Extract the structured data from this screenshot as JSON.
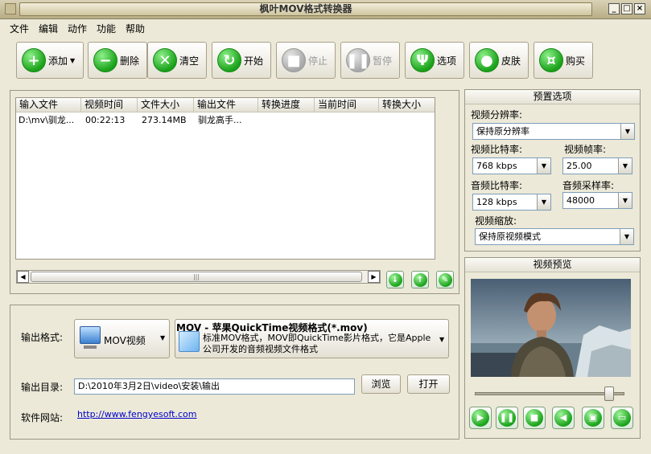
{
  "window": {
    "title": "枫叶MOV格式转换器",
    "min": "_",
    "max": "□",
    "close": "×"
  },
  "menu": [
    "文件",
    "编辑",
    "动作",
    "功能",
    "帮助"
  ],
  "toolbar": {
    "add": "添加",
    "delete": "删除",
    "clear": "清空",
    "start": "开始",
    "stop": "停止",
    "pause": "暂停",
    "options": "选项",
    "skin": "皮肤",
    "buy": "购买"
  },
  "table": {
    "headers": [
      "输入文件",
      "视频时间",
      "文件大小",
      "输出文件",
      "转换进度",
      "当前时间",
      "转换大小"
    ],
    "rows": [
      [
        "D:\\mv\\驯龙...",
        "00:22:13",
        "273.14MB",
        "驯龙高手...",
        "",
        "",
        ""
      ]
    ]
  },
  "output": {
    "format_label": "输出格式:",
    "format_button": "MOV视频",
    "format_title": "MOV - 苹果QuickTime视频格式(*.mov)",
    "format_desc": "标准MOV格式，MOV即QuickTime影片格式，它是Apple公司开发的音频视频文件格式",
    "dir_label": "输出目录:",
    "dir_value": "D:\\2010年3月2日\\video\\安装\\输出",
    "browse": "浏览",
    "open": "打开",
    "site_label": "软件网站:",
    "site_url": "http://www.fengyesoft.com"
  },
  "preset": {
    "title": "预置选项",
    "resolution_label": "视频分辨率:",
    "resolution_value": "保持原分辨率",
    "vbitrate_label": "视频比特率:",
    "vbitrate_value": "768 kbps",
    "framerate_label": "视频帧率:",
    "framerate_value": "25.00",
    "abitrate_label": "音频比特率:",
    "abitrate_value": "128 kbps",
    "samplerate_label": "音频采样率:",
    "samplerate_value": "48000",
    "scale_label": "视频缩放:",
    "scale_value": "保持原视频模式"
  },
  "preview": {
    "title": "视频预览",
    "seek_position": 0.9
  }
}
